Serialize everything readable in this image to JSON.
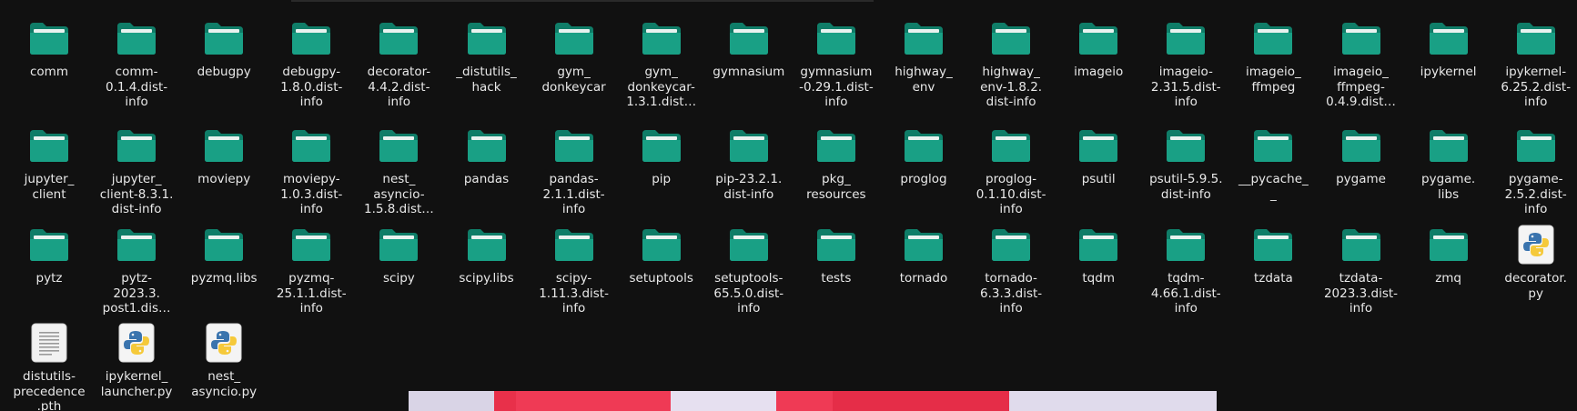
{
  "colors": {
    "background": "#111111",
    "folder_dark": "#0f7d68",
    "folder_light": "#19a085",
    "label_text": "#e9e9e9"
  },
  "rows": [
    [
      {
        "name": "comm",
        "type": "folder",
        "icon": "folder-icon"
      },
      {
        "name": "comm-\n0.1.4.dist-\ninfo",
        "type": "folder",
        "icon": "folder-icon"
      },
      {
        "name": "debugpy",
        "type": "folder",
        "icon": "folder-icon"
      },
      {
        "name": "debugpy-\n1.8.0.dist-\ninfo",
        "type": "folder",
        "icon": "folder-icon"
      },
      {
        "name": "decorator-\n4.4.2.dist-\ninfo",
        "type": "folder",
        "icon": "folder-icon"
      },
      {
        "name": "_distutils_\nhack",
        "type": "folder",
        "icon": "folder-icon"
      },
      {
        "name": "gym_\ndonkeycar",
        "type": "folder",
        "icon": "folder-icon"
      },
      {
        "name": "gym_\ndonkeycar-\n1.3.1.dist…",
        "type": "folder",
        "icon": "folder-icon"
      },
      {
        "name": "gymnasium",
        "type": "folder",
        "icon": "folder-icon"
      },
      {
        "name": "gymnasium\n-0.29.1.dist-\ninfo",
        "type": "folder",
        "icon": "folder-icon"
      },
      {
        "name": "highway_\nenv",
        "type": "folder",
        "icon": "folder-icon"
      },
      {
        "name": "highway_\nenv-1.8.2.\ndist-info",
        "type": "folder",
        "icon": "folder-icon"
      },
      {
        "name": "imageio",
        "type": "folder",
        "icon": "folder-icon"
      },
      {
        "name": "imageio-\n2.31.5.dist-\ninfo",
        "type": "folder",
        "icon": "folder-icon"
      },
      {
        "name": "imageio_\nffmpeg",
        "type": "folder",
        "icon": "folder-icon"
      },
      {
        "name": "imageio_\nffmpeg-\n0.4.9.dist…",
        "type": "folder",
        "icon": "folder-icon"
      },
      {
        "name": "ipykernel",
        "type": "folder",
        "icon": "folder-icon"
      },
      {
        "name": "ipykernel-\n6.25.2.dist-\ninfo",
        "type": "folder",
        "icon": "folder-icon"
      }
    ],
    [
      {
        "name": "jupyter_\nclient",
        "type": "folder",
        "icon": "folder-icon"
      },
      {
        "name": "jupyter_\nclient-8.3.1.\ndist-info",
        "type": "folder",
        "icon": "folder-icon"
      },
      {
        "name": "moviepy",
        "type": "folder",
        "icon": "folder-icon"
      },
      {
        "name": "moviepy-\n1.0.3.dist-\ninfo",
        "type": "folder",
        "icon": "folder-icon"
      },
      {
        "name": "nest_\nasyncio-\n1.5.8.dist…",
        "type": "folder",
        "icon": "folder-icon"
      },
      {
        "name": "pandas",
        "type": "folder",
        "icon": "folder-icon"
      },
      {
        "name": "pandas-\n2.1.1.dist-\ninfo",
        "type": "folder",
        "icon": "folder-icon"
      },
      {
        "name": "pip",
        "type": "folder",
        "icon": "folder-icon"
      },
      {
        "name": "pip-23.2.1.\ndist-info",
        "type": "folder",
        "icon": "folder-icon"
      },
      {
        "name": "pkg_\nresources",
        "type": "folder",
        "icon": "folder-icon"
      },
      {
        "name": "proglog",
        "type": "folder",
        "icon": "folder-icon"
      },
      {
        "name": "proglog-\n0.1.10.dist-\ninfo",
        "type": "folder",
        "icon": "folder-icon"
      },
      {
        "name": "psutil",
        "type": "folder",
        "icon": "folder-icon"
      },
      {
        "name": "psutil-5.9.5.\ndist-info",
        "type": "folder",
        "icon": "folder-icon"
      },
      {
        "name": "__pycache_\n_",
        "type": "folder",
        "icon": "folder-icon"
      },
      {
        "name": "pygame",
        "type": "folder",
        "icon": "folder-icon"
      },
      {
        "name": "pygame.\nlibs",
        "type": "folder",
        "icon": "folder-icon"
      },
      {
        "name": "pygame-\n2.5.2.dist-\ninfo",
        "type": "folder",
        "icon": "folder-icon"
      }
    ],
    [
      {
        "name": "pytz",
        "type": "folder",
        "icon": "folder-icon"
      },
      {
        "name": "pytz-\n2023.3.\npost1.dis…",
        "type": "folder",
        "icon": "folder-icon"
      },
      {
        "name": "pyzmq.libs",
        "type": "folder",
        "icon": "folder-icon"
      },
      {
        "name": "pyzmq-\n25.1.1.dist-\ninfo",
        "type": "folder",
        "icon": "folder-icon"
      },
      {
        "name": "scipy",
        "type": "folder",
        "icon": "folder-icon"
      },
      {
        "name": "scipy.libs",
        "type": "folder",
        "icon": "folder-icon"
      },
      {
        "name": "scipy-\n1.11.3.dist-\ninfo",
        "type": "folder",
        "icon": "folder-icon"
      },
      {
        "name": "setuptools",
        "type": "folder",
        "icon": "folder-icon"
      },
      {
        "name": "setuptools-\n65.5.0.dist-\ninfo",
        "type": "folder",
        "icon": "folder-icon"
      },
      {
        "name": "tests",
        "type": "folder",
        "icon": "folder-icon"
      },
      {
        "name": "tornado",
        "type": "folder",
        "icon": "folder-icon"
      },
      {
        "name": "tornado-\n6.3.3.dist-\ninfo",
        "type": "folder",
        "icon": "folder-icon"
      },
      {
        "name": "tqdm",
        "type": "folder",
        "icon": "folder-icon"
      },
      {
        "name": "tqdm-\n4.66.1.dist-\ninfo",
        "type": "folder",
        "icon": "folder-icon"
      },
      {
        "name": "tzdata",
        "type": "folder",
        "icon": "folder-icon"
      },
      {
        "name": "tzdata-\n2023.3.dist-\ninfo",
        "type": "folder",
        "icon": "folder-icon"
      },
      {
        "name": "zmq",
        "type": "folder",
        "icon": "folder-icon"
      },
      {
        "name": "decorator.\npy",
        "type": "python",
        "icon": "python-file-icon"
      }
    ],
    [
      {
        "name": "distutils-\nprecedence\n.pth",
        "type": "text",
        "icon": "text-file-icon"
      },
      {
        "name": "ipykernel_\nlauncher.py",
        "type": "python",
        "icon": "python-file-icon"
      },
      {
        "name": "nest_\nasyncio.py",
        "type": "python",
        "icon": "python-file-icon"
      }
    ]
  ],
  "bottom_strip": [
    "#d9d4e6",
    "#e8304a",
    "#ef3a55",
    "#e6e0f0",
    "#ef3a55",
    "#e52d48",
    "#e0dbec"
  ]
}
